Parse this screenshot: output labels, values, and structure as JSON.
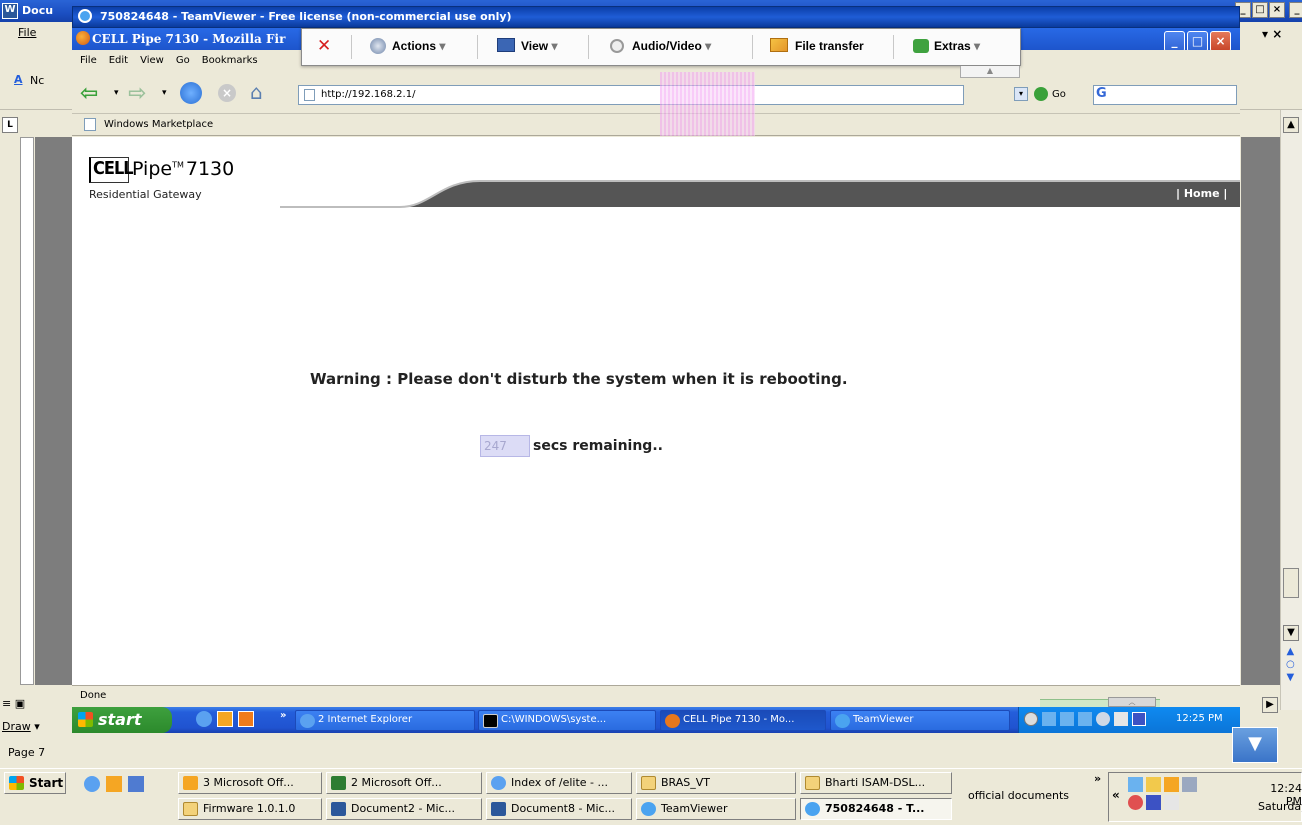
{
  "word": {
    "title_short": "Docu",
    "menu_file": "File",
    "font_box": "Nc",
    "draw_label": "Draw",
    "page_label": "Page 7"
  },
  "teamviewer": {
    "window_title": "750824648 - TeamViewer - Free license (non-commercial use only)",
    "toolbar": {
      "close": "✕",
      "actions": "Actions",
      "view": "View",
      "audio_video": "Audio/Video",
      "file_transfer": "File transfer",
      "extras": "Extras"
    }
  },
  "firefox": {
    "window_title": "CELL Pipe 7130 - Mozilla Fir",
    "menu": [
      "File",
      "Edit",
      "View",
      "Go",
      "Bookmarks"
    ],
    "url": "http://192.168.2.1/",
    "go_label": "Go",
    "bookmark": "Windows Marketplace",
    "status": "Done"
  },
  "page": {
    "logo_cell": "CELL",
    "logo_pipe": "Pipe",
    "logo_tm": "TM",
    "logo_model": "7130",
    "logo_sub": "Residential Gateway",
    "home_link": "| Home |",
    "warning": "Warning : Please don't disturb the system when it is rebooting.",
    "countdown_value": "247",
    "countdown_suffix": "secs remaining.."
  },
  "remote_taskbar": {
    "start": "start",
    "buttons": [
      "2 Internet Explorer",
      "C:\\WINDOWS\\syste...",
      "CELL Pipe 7130 - Mo...",
      "TeamViewer"
    ],
    "clock": "12:25 PM"
  },
  "local_taskbar": {
    "start": "Start",
    "row1": [
      "3 Microsoft Off...",
      "2 Microsoft Off...",
      "Index of /elite - ...",
      "BRAS_VT",
      "Bharti ISAM-DSL..."
    ],
    "row2": [
      "Firmware 1.0.1.0",
      "Document2 - Mic...",
      "Document8 - Mic...",
      "TeamViewer",
      "750824648 - T..."
    ],
    "toolbar_label": "official documents",
    "clock": "12:24 PM",
    "day": "Saturday"
  },
  "colors": {
    "xp_blue": "#245edb",
    "start_green": "#2c8a2c",
    "countdown_bg": "#dcdcf6"
  }
}
